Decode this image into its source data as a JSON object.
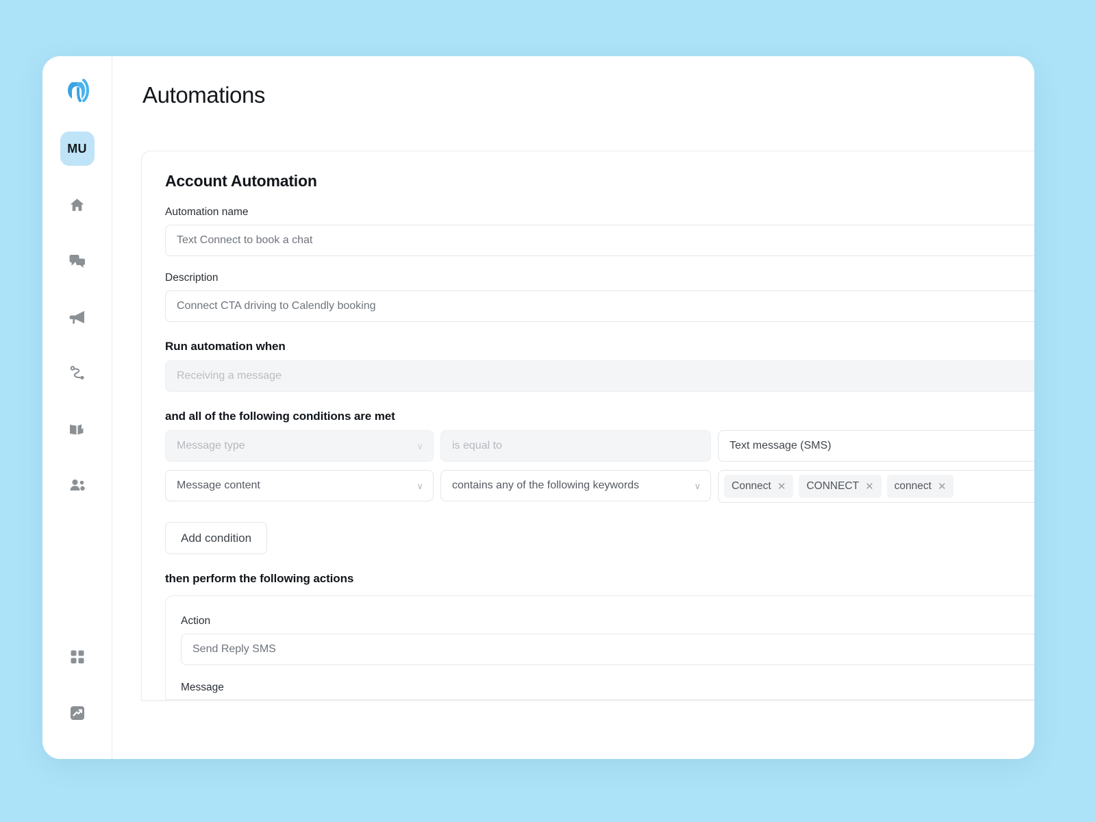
{
  "theme": {
    "page_background": "#ade3f8",
    "brand_blue": "#3ba3e0",
    "avatar_background": "#bfe3f7",
    "chip_background": "#f3f4f5",
    "disabled_background": "#f4f5f6"
  },
  "sidebar": {
    "logo_name": "brand-logo",
    "avatar_initials": "MU",
    "items": [
      {
        "name": "home-icon",
        "label": "Home"
      },
      {
        "name": "chat-bubbles-icon",
        "label": "Inbox"
      },
      {
        "name": "megaphone-icon",
        "label": "Campaigns"
      },
      {
        "name": "automation-flow-icon",
        "label": "Automations"
      },
      {
        "name": "book-icon",
        "label": "Library"
      },
      {
        "name": "people-icon",
        "label": "Contacts"
      }
    ],
    "bottom_items": [
      {
        "name": "grid-apps-icon",
        "label": "Apps"
      },
      {
        "name": "analytics-trending-icon",
        "label": "Analytics"
      }
    ]
  },
  "header": {
    "title": "Automations"
  },
  "card": {
    "title": "Account Automation",
    "automation_name": {
      "label": "Automation name",
      "value": "Text Connect to book a chat"
    },
    "description": {
      "label": "Description",
      "value": "Connect CTA driving to Calendly booking"
    },
    "trigger": {
      "label": "Run automation when",
      "value": "Receiving a message",
      "disabled": true
    },
    "conditions": {
      "label": "and all of the following conditions are met",
      "rows": [
        {
          "field": "Message type",
          "field_disabled": true,
          "operator": "is equal to",
          "operator_disabled": true,
          "value_type": "text",
          "value": "Text message (SMS)"
        },
        {
          "field": "Message content",
          "field_disabled": false,
          "operator": "contains any of the following keywords",
          "operator_disabled": false,
          "value_type": "chips",
          "chips": [
            "Connect",
            "CONNECT",
            "connect"
          ],
          "chip_remove_glyph": "✕"
        }
      ],
      "add_condition_label": "Add condition"
    },
    "actions": {
      "label": "then perform the following actions",
      "action_label": "Action",
      "action_value": "Send Reply SMS",
      "message_label": "Message"
    }
  },
  "glyphs": {
    "chevron_down": "∨"
  }
}
